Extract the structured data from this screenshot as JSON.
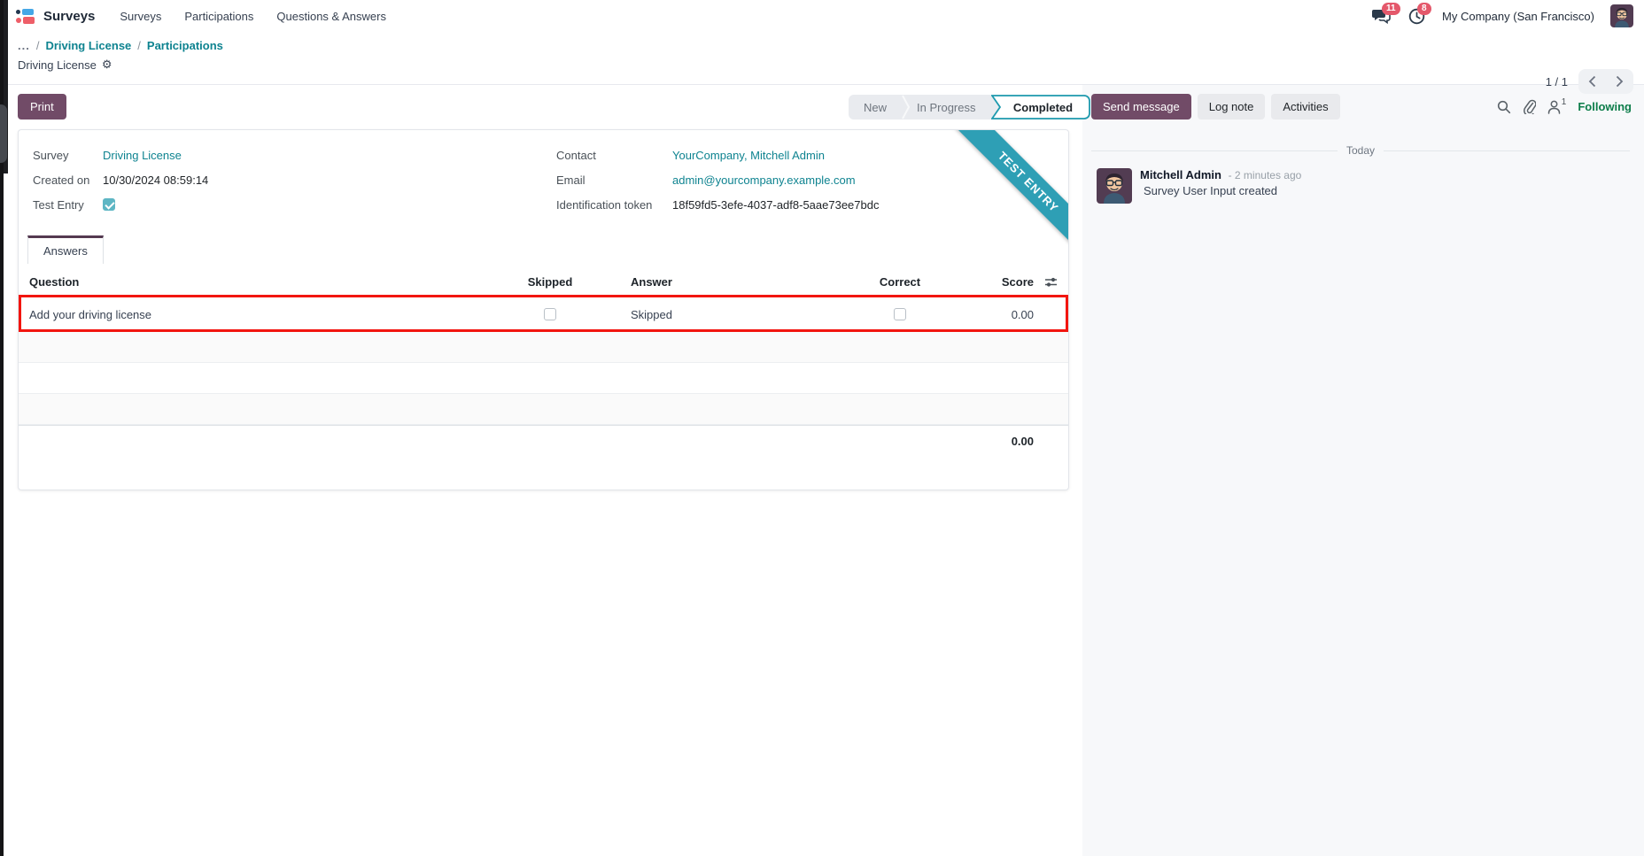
{
  "topbar": {
    "brand": "Surveys",
    "menus": [
      {
        "label": "Surveys"
      },
      {
        "label": "Participations"
      },
      {
        "label": "Questions & Answers"
      }
    ],
    "messages_badge": "11",
    "activities_badge": "8",
    "company": "My Company (San Francisco)"
  },
  "breadcrumb": {
    "collapsed": "...",
    "sep": "/",
    "link1": "Driving License",
    "link2": "Participations",
    "title": "Driving License",
    "gear_icon": "⚙"
  },
  "pager": {
    "value": "1 / 1"
  },
  "actions": {
    "print": "Print"
  },
  "stages": {
    "new": "New",
    "in_progress": "In Progress",
    "completed": "Completed",
    "active": "Completed"
  },
  "form": {
    "survey_label": "Survey",
    "survey_value": "Driving License",
    "created_label": "Created on",
    "created_value": "10/30/2024 08:59:14",
    "test_entry_label": "Test Entry",
    "test_entry_checked": true,
    "contact_label": "Contact",
    "contact_value": "YourCompany, Mitchell Admin",
    "email_label": "Email",
    "email_value": "admin@yourcompany.example.com",
    "token_label": "Identification token",
    "token_value": "18f59fd5-3efe-4037-adf8-5aae73ee7bdc"
  },
  "ribbon": {
    "text": "TEST ENTRY"
  },
  "tabs": {
    "active": "Answers"
  },
  "table": {
    "headers": {
      "question": "Question",
      "skipped": "Skipped",
      "answer": "Answer",
      "correct": "Correct",
      "score": "Score"
    },
    "rows": [
      {
        "question": "Add your driving license",
        "skipped_checked": false,
        "answer": "Skipped",
        "correct_checked": false,
        "score": "0.00",
        "highlighted": true
      }
    ],
    "empty_row_count": 3,
    "total_score": "0.00"
  },
  "chatter": {
    "send_message": "Send message",
    "log_note": "Log note",
    "activities": "Activities",
    "follower_count": "1",
    "following": "Following",
    "divider": "Today",
    "messages": [
      {
        "author": "Mitchell Admin",
        "time": "- 2 minutes ago",
        "body": "Survey User Input created"
      }
    ]
  },
  "colors": {
    "primary": "#714B67",
    "link": "#0e8390",
    "ribbon": "#2e9fb5",
    "highlight_border": "#f2150f",
    "stage_active_border": "#1e9aae",
    "badge": "#e4586b",
    "following": "#0d7d4a",
    "checkbox_checked": "#5eb6c4"
  }
}
